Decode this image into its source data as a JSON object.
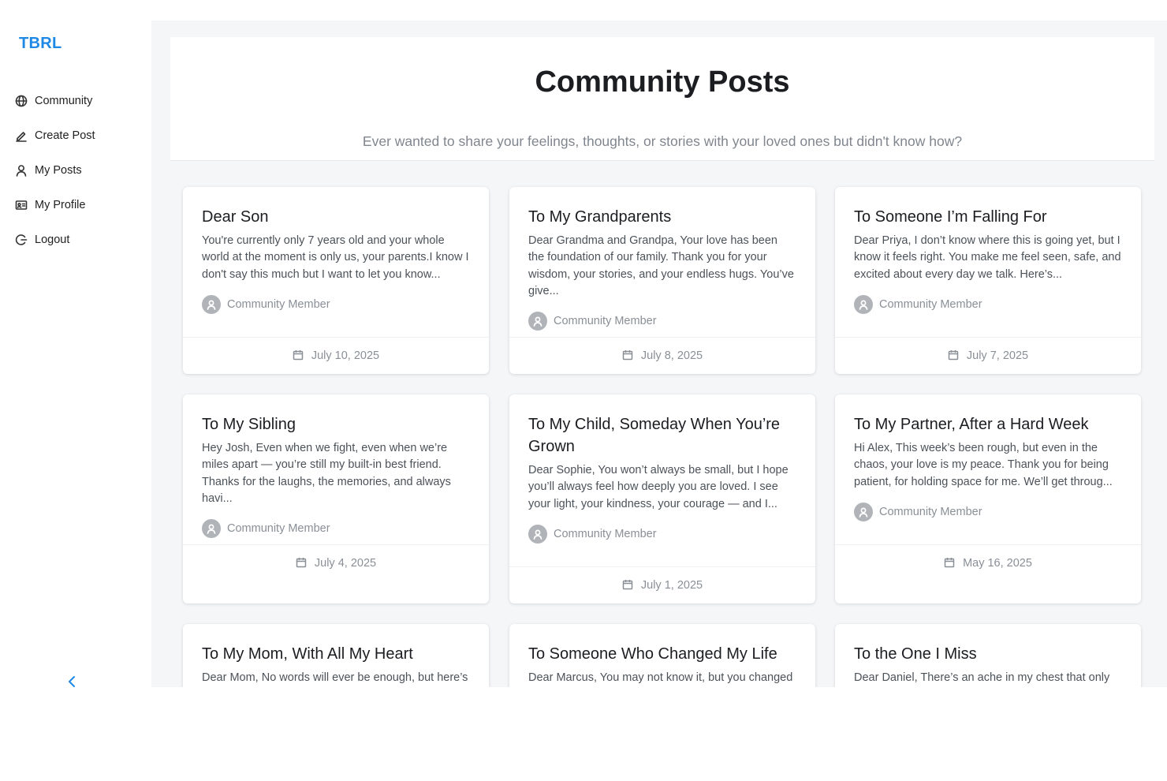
{
  "app": {
    "brand": "TBRL"
  },
  "sidebar": {
    "items": [
      {
        "label": "Community",
        "icon": "globe-icon"
      },
      {
        "label": "Create Post",
        "icon": "pen-icon"
      },
      {
        "label": "My Posts",
        "icon": "user-icon"
      },
      {
        "label": "My Profile",
        "icon": "id-card-icon"
      },
      {
        "label": "Logout",
        "icon": "logout-icon"
      }
    ],
    "collapse_icon": "chevron-left-icon"
  },
  "header": {
    "title": "Community Posts",
    "subtitle": "Ever wanted to share your feelings, thoughts, or stories with your loved ones but didn't know how?"
  },
  "posts": [
    {
      "title": "Dear Son",
      "excerpt": "You're currently only 7 years old and your whole world at the moment is only us, your parents.I know I don't say this much but I want to let you know...",
      "author": "Community Member",
      "date": "July 10, 2025"
    },
    {
      "title": "To My Grandparents",
      "excerpt": "Dear Grandma and Grandpa, Your love has been the foundation of our family. Thank you for your wisdom, your stories, and your endless hugs. You’ve give...",
      "author": "Community Member",
      "date": "July 8, 2025"
    },
    {
      "title": "To Someone I’m Falling For",
      "excerpt": "Dear Priya, I don’t know where this is going yet, but I know it feels right. You make me feel seen, safe, and excited about every day we talk. Here’s...",
      "author": "Community Member",
      "date": "July 7, 2025"
    },
    {
      "title": "To My Sibling",
      "excerpt": "Hey Josh, Even when we fight, even when we’re miles apart — you’re still my built-in best friend. Thanks for the laughs, the memories, and always havi...",
      "author": "Community Member",
      "date": "July 4, 2025"
    },
    {
      "title": "To My Child, Someday When You’re Grown",
      "excerpt": "Dear Sophie, You won’t always be small, but I hope you’ll always feel how deeply you are loved. I see your light, your kindness, your courage — and I...",
      "author": "Community Member",
      "date": "July 1, 2025"
    },
    {
      "title": "To My Partner, After a Hard Week",
      "excerpt": "Hi Alex, This week’s been rough, but even in the chaos, your love is my peace. Thank you for being patient, for holding space for me. We’ll get throug...",
      "author": "Community Member",
      "date": "May 16, 2025"
    },
    {
      "title": "To My Mom, With All My Heart",
      "excerpt": "Dear Mom, No words will ever be enough, but here’s a",
      "author": "",
      "date": ""
    },
    {
      "title": "To Someone Who Changed My Life",
      "excerpt": "Dear Marcus, You may not know it, but you changed",
      "author": "",
      "date": ""
    },
    {
      "title": "To the One I Miss",
      "excerpt": "Dear Daniel, There’s an ache in my chest that only your",
      "author": "",
      "date": ""
    }
  ]
}
